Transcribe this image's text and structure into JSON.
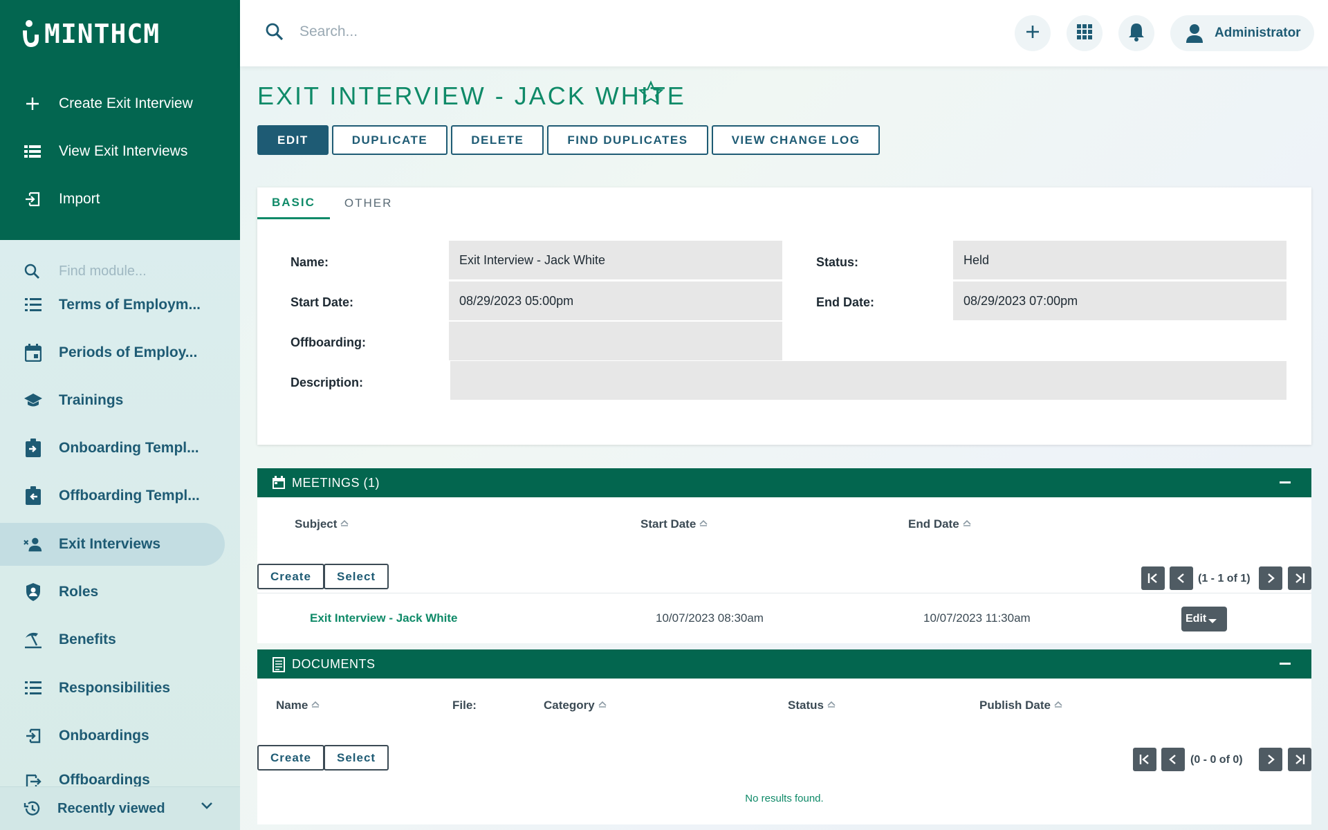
{
  "app": {
    "logo": "MINTHCM"
  },
  "sidebar": {
    "quick_actions": [
      {
        "label": "Create Exit Interview",
        "icon": "plus-icon"
      },
      {
        "label": "View Exit Interviews",
        "icon": "list-view-icon"
      },
      {
        "label": "Import",
        "icon": "import-icon"
      }
    ],
    "find_module_placeholder": "Find module...",
    "modules": [
      {
        "label": "Terms of Employm...",
        "icon": "list-icon"
      },
      {
        "label": "Periods of Employ...",
        "icon": "calendar-icon"
      },
      {
        "label": "Trainings",
        "icon": "graduation-cap-icon"
      },
      {
        "label": "Onboarding Templ...",
        "icon": "clipboard-in-icon"
      },
      {
        "label": "Offboarding Templ...",
        "icon": "clipboard-out-icon"
      },
      {
        "label": "Exit Interviews",
        "icon": "person-remove-icon",
        "active": true
      },
      {
        "label": "Roles",
        "icon": "shield-person-icon"
      },
      {
        "label": "Benefits",
        "icon": "beach-umbrella-icon"
      },
      {
        "label": "Responsibilities",
        "icon": "list-icon"
      },
      {
        "label": "Onboardings",
        "icon": "login-icon"
      },
      {
        "label": "Offboardings",
        "icon": "logout-icon"
      }
    ],
    "recently_viewed": "Recently viewed"
  },
  "topbar": {
    "search_placeholder": "Search...",
    "user": "Administrator"
  },
  "record": {
    "title": "EXIT INTERVIEW - JACK WHITE",
    "actions": [
      "EDIT",
      "DUPLICATE",
      "DELETE",
      "FIND DUPLICATES",
      "VIEW CHANGE LOG"
    ],
    "tabs": [
      "BASIC",
      "OTHER"
    ],
    "fields": {
      "name_label": "Name:",
      "name_value": "Exit Interview - Jack White",
      "status_label": "Status:",
      "status_value": "Held",
      "start_label": "Start Date:",
      "start_value": "08/29/2023 05:00pm",
      "end_label": "End Date:",
      "end_value": "08/29/2023 07:00pm",
      "offboarding_label": "Offboarding:",
      "offboarding_value": "",
      "description_label": "Description:",
      "description_value": ""
    }
  },
  "meetings": {
    "title": "MEETINGS (1)",
    "columns": [
      "Subject",
      "Start Date",
      "End Date"
    ],
    "create": "Create",
    "select": "Select",
    "pagination": "(1 - 1 of 1)",
    "rows": [
      {
        "subject": "Exit Interview - Jack White",
        "start": "10/07/2023 08:30am",
        "end": "10/07/2023 11:30am",
        "action": "Edit"
      }
    ]
  },
  "documents": {
    "title": "DOCUMENTS",
    "columns": [
      "Name",
      "File:",
      "Category",
      "Status",
      "Publish Date"
    ],
    "create": "Create",
    "select": "Select",
    "pagination": "(0 - 0 of 0)",
    "empty": "No results found."
  },
  "colors": {
    "brand_green": "#036650",
    "accent_teal": "#0f8a68",
    "nav_blue": "#1e5b74"
  }
}
